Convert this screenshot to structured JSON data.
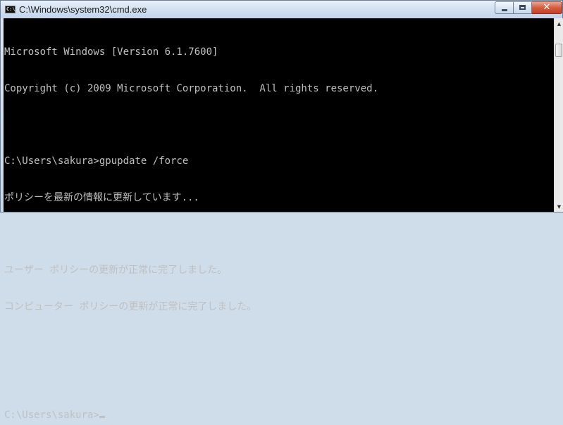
{
  "window": {
    "title": "C:\\Windows\\system32\\cmd.exe",
    "icon_text": "C:\\",
    "icon": "console-icon",
    "controls": {
      "minimize_icon": "minimize-icon",
      "maximize_icon": "maximize-icon",
      "close_icon": "close-icon",
      "close_glyph": "✕"
    }
  },
  "console": {
    "lines": [
      "Microsoft Windows [Version 6.1.7600]",
      "Copyright (c) 2009 Microsoft Corporation.  All rights reserved.",
      "",
      "C:\\Users\\sakura>gpupdate /force",
      "ポリシーを最新の情報に更新しています...",
      "",
      "ユーザー ポリシーの更新が正常に完了しました。",
      "コンピューター ポリシーの更新が正常に完了しました。",
      "",
      "",
      "C:\\Users\\sakura>"
    ],
    "colors": {
      "background": "#000000",
      "foreground": "#c0c0c0"
    }
  },
  "scrollbar": {
    "up_glyph": "▲",
    "down_glyph": "▼"
  }
}
